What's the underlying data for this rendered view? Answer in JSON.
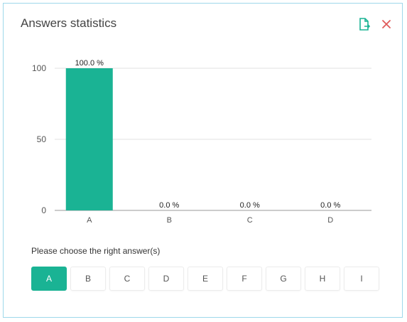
{
  "dialog": {
    "title": "Answers statistics",
    "export_icon": "export-document-icon",
    "close_icon": "close-icon",
    "accent_color": "#1ab394",
    "close_color": "#e05a5a"
  },
  "chart_data": {
    "type": "bar",
    "categories": [
      "A",
      "B",
      "C",
      "D"
    ],
    "values": [
      100.0,
      0.0,
      0.0,
      0.0
    ],
    "data_labels": [
      "100.0 %",
      "0.0 %",
      "0.0 %",
      "0.0 %"
    ],
    "yticks": [
      0,
      50,
      100
    ],
    "ylim": [
      0,
      100
    ],
    "grid": true,
    "bar_color": "#1ab394",
    "title": "",
    "xlabel": "",
    "ylabel": ""
  },
  "answer": {
    "prompt": "Please choose the right answer(s)",
    "options": [
      "A",
      "B",
      "C",
      "D",
      "E",
      "F",
      "G",
      "H",
      "I"
    ],
    "selected": "A"
  }
}
